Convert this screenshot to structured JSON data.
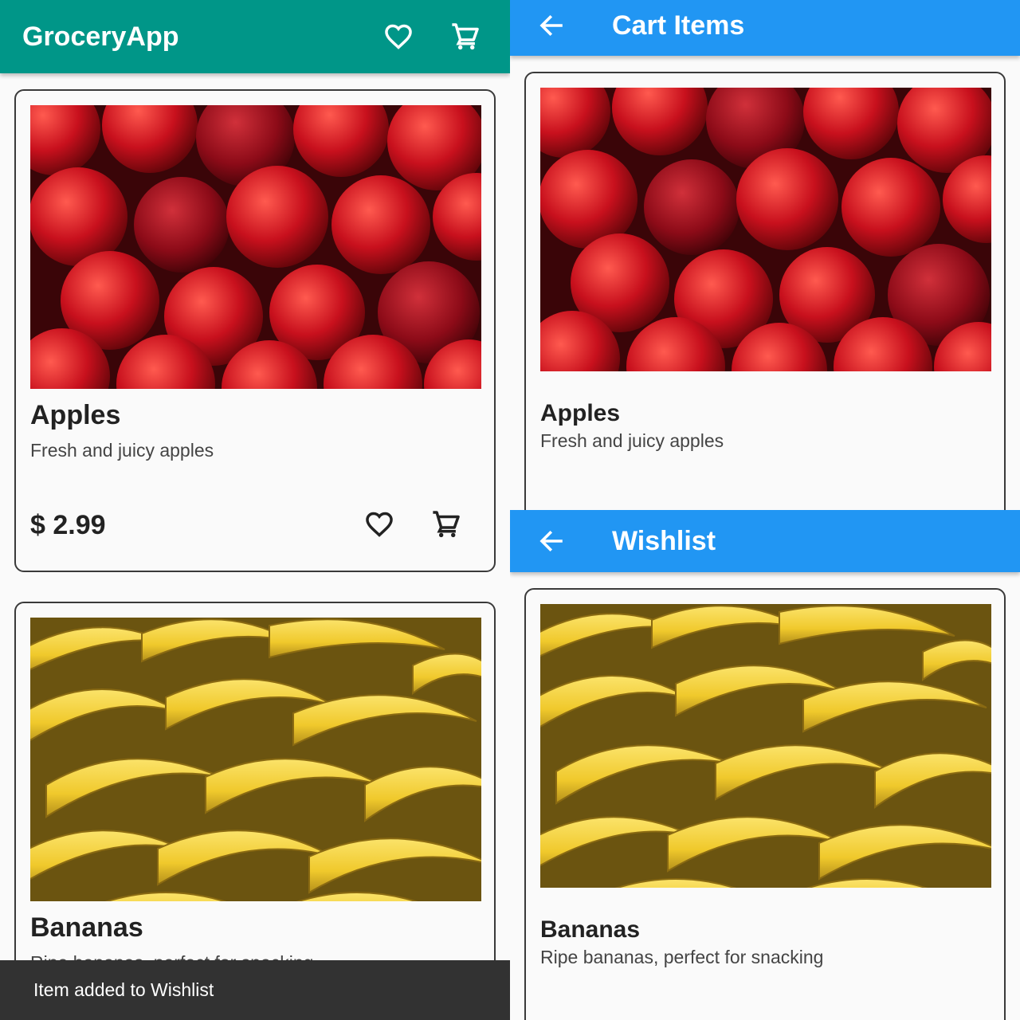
{
  "home": {
    "app_title": "GroceryApp",
    "icons": {
      "wishlist": "heart-outline-icon",
      "cart": "cart-icon"
    },
    "products": [
      {
        "name": "Apples",
        "description": "Fresh and juicy apples",
        "price": "$ 2.99",
        "image": "apples-photo"
      },
      {
        "name": "Bananas",
        "description": "Ripe bananas, perfect for snacking",
        "image": "bananas-photo"
      }
    ],
    "snackbar": "Item added to Wishlist"
  },
  "cart": {
    "title": "Cart Items",
    "items": [
      {
        "name": "Apples",
        "description": "Fresh and juicy apples",
        "image": "apples-photo"
      }
    ]
  },
  "wishlist": {
    "title": "Wishlist",
    "items": [
      {
        "name": "Bananas",
        "description": "Ripe bananas, perfect for snacking",
        "image": "bananas-photo"
      }
    ]
  },
  "colors": {
    "home_appbar": "#009688",
    "nav_appbar": "#2196f3",
    "snackbar": "#323232"
  }
}
